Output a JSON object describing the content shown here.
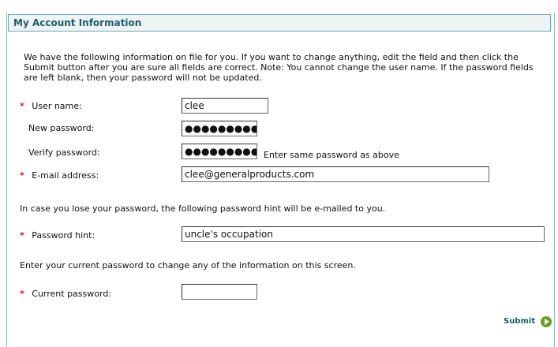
{
  "header": {
    "title": "My Account Information"
  },
  "intro": "We have the following information on file for you. If you want to change anything, edit the field and then click the Submit button after you are sure all fields are correct. Note: You cannot change the user name. If the password fields are left blank, then your password will not be updated.",
  "fields": {
    "required_marker": "*",
    "username": {
      "label": "User name:",
      "value": "clee"
    },
    "new_password": {
      "label": "New password:",
      "value": "●●●●●●●●●"
    },
    "verify_password": {
      "label": "Verify password:",
      "value": "●●●●●●●●●",
      "note": "Enter same password as above"
    },
    "email": {
      "label": "E-mail address:",
      "value": "clee@generalproducts.com"
    },
    "hint_intro": "In case you lose your password, the following password hint will be e-mailed to you.",
    "password_hint": {
      "label": "Password hint:",
      "value": "uncle's occupation"
    },
    "current_intro": "Enter your current password to change any of the information on this screen.",
    "current_password": {
      "label": "Current password:",
      "value": ""
    }
  },
  "actions": {
    "submit": "Submit"
  },
  "colors": {
    "accent": "#1e5d6e",
    "required": "#d11919",
    "submit_icon": "#6a9d28"
  }
}
